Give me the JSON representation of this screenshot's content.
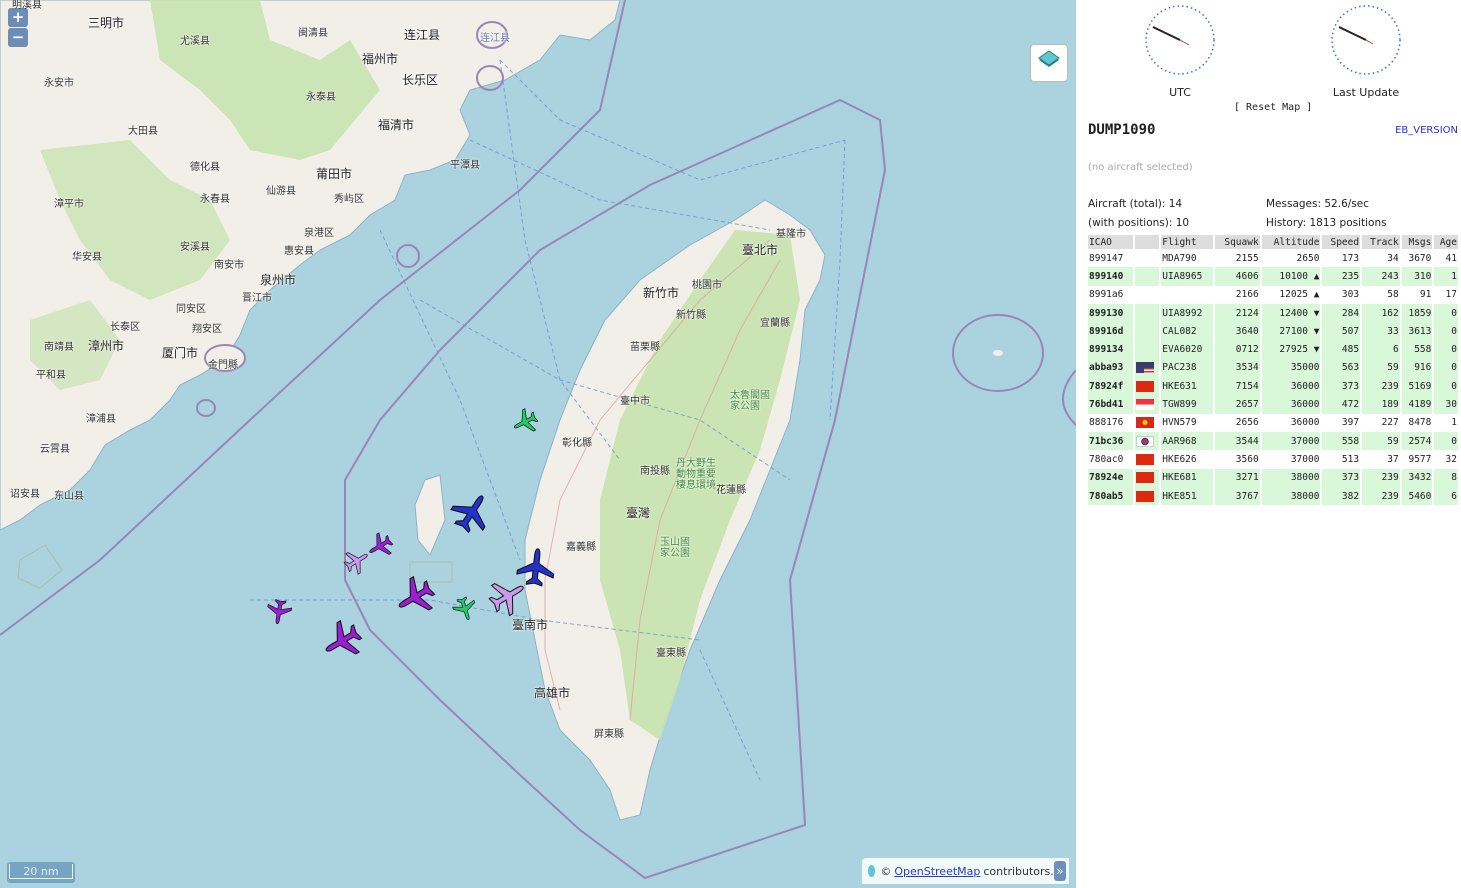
{
  "map": {
    "zoom_in": "+",
    "zoom_out": "−",
    "scale_label": "20 nm",
    "attribution_prefix": "©",
    "attribution_link": "OpenStreetMap",
    "attribution_suffix": "contributors.",
    "attribution_toggle": "»",
    "places": [
      {
        "text": "明溪县"
      },
      {
        "text": "三明市"
      },
      {
        "text": "尤溪县"
      },
      {
        "text": "闽清县"
      },
      {
        "text": "连江县"
      },
      {
        "text": "福州市"
      },
      {
        "text": "长乐区"
      },
      {
        "text": "永安市"
      },
      {
        "text": "永泰县"
      },
      {
        "text": "大田县"
      },
      {
        "text": "福清市"
      },
      {
        "text": "德化县"
      },
      {
        "text": "永春县"
      },
      {
        "text": "仙游县"
      },
      {
        "text": "莆田市"
      },
      {
        "text": "秀屿区"
      },
      {
        "text": "平潭县"
      },
      {
        "text": "漳平市"
      },
      {
        "text": "泉州市"
      },
      {
        "text": "泉港区"
      },
      {
        "text": "华安县"
      },
      {
        "text": "安溪县"
      },
      {
        "text": "惠安县"
      },
      {
        "text": "南安市"
      },
      {
        "text": "晋江市"
      },
      {
        "text": "同安区"
      },
      {
        "text": "长泰区"
      },
      {
        "text": "翔安区"
      },
      {
        "text": "南靖县"
      },
      {
        "text": "漳州市"
      },
      {
        "text": "厦门市"
      },
      {
        "text": "金門縣"
      },
      {
        "text": "平和县"
      },
      {
        "text": "漳浦县"
      },
      {
        "text": "云霄县"
      },
      {
        "text": "诏安县"
      },
      {
        "text": "东山县"
      },
      {
        "text": "基隆市"
      },
      {
        "text": "臺北市"
      },
      {
        "text": "桃園市"
      },
      {
        "text": "新竹市"
      },
      {
        "text": "新竹縣"
      },
      {
        "text": "宜蘭縣"
      },
      {
        "text": "苗栗縣"
      },
      {
        "text": "臺中市"
      },
      {
        "text": "彰化縣"
      },
      {
        "text": "南投縣"
      },
      {
        "text": "花蓮縣"
      },
      {
        "text": "臺灣"
      },
      {
        "text": "嘉義縣"
      },
      {
        "text": "臺南市"
      },
      {
        "text": "高雄市"
      },
      {
        "text": "臺東縣"
      },
      {
        "text": "屏東縣"
      },
      {
        "text": "太魯閣國家公園"
      },
      {
        "text": "玉山國家公園"
      },
      {
        "text": "丹大野生動物重要棲息環境"
      },
      {
        "text": "连江县"
      }
    ]
  },
  "sidebar": {
    "clock_utc": "UTC",
    "clock_last_update": "Last Update",
    "reset_map": "[ Reset Map ]",
    "title": "DUMP1090",
    "version": "EB_VERSION",
    "no_selection": "(no aircraft selected)",
    "stats": {
      "total": "Aircraft (total): 14",
      "messages": "Messages: 52.6/sec",
      "with_positions": "(with positions): 10",
      "history": "History: 1813 positions"
    },
    "columns": [
      "ICAO",
      "",
      "Flight",
      "Squawk",
      "Altitude",
      "Speed",
      "Track",
      "Msgs",
      "Age"
    ],
    "rows": [
      {
        "icao": "899147",
        "flag": "",
        "flight": "MDA790",
        "squawk": "2155",
        "altitude": "2650",
        "speed": "173",
        "track": "34",
        "msgs": "3670",
        "age": "41",
        "pos": false
      },
      {
        "icao": "899140",
        "flag": "",
        "flight": "UIA8965",
        "squawk": "4606",
        "altitude": "10100 ▲",
        "speed": "235",
        "track": "243",
        "msgs": "310",
        "age": "1",
        "pos": true
      },
      {
        "icao": "8991a6",
        "flag": "",
        "flight": "",
        "squawk": "2166",
        "altitude": "12025 ▲",
        "speed": "303",
        "track": "58",
        "msgs": "91",
        "age": "17",
        "pos": false
      },
      {
        "icao": "899130",
        "flag": "",
        "flight": "UIA8992",
        "squawk": "2124",
        "altitude": "12400 ▼",
        "speed": "284",
        "track": "162",
        "msgs": "1859",
        "age": "0",
        "pos": true
      },
      {
        "icao": "89916d",
        "flag": "",
        "flight": "CAL082",
        "squawk": "3640",
        "altitude": "27100 ▼",
        "speed": "507",
        "track": "33",
        "msgs": "3613",
        "age": "0",
        "pos": true
      },
      {
        "icao": "899134",
        "flag": "",
        "flight": "EVA6020",
        "squawk": "0712",
        "altitude": "27925 ▼",
        "speed": "485",
        "track": "6",
        "msgs": "558",
        "age": "0",
        "pos": true
      },
      {
        "icao": "abba93",
        "flag": "us",
        "flight": "PAC238",
        "squawk": "3534",
        "altitude": "35000",
        "speed": "563",
        "track": "59",
        "msgs": "916",
        "age": "0",
        "pos": true
      },
      {
        "icao": "78924f",
        "flag": "cn",
        "flight": "HKE631",
        "squawk": "7154",
        "altitude": "36000",
        "speed": "373",
        "track": "239",
        "msgs": "5169",
        "age": "0",
        "pos": true
      },
      {
        "icao": "76bd41",
        "flag": "sg",
        "flight": "TGW899",
        "squawk": "2657",
        "altitude": "36000",
        "speed": "472",
        "track": "189",
        "msgs": "4189",
        "age": "30",
        "pos": true
      },
      {
        "icao": "888176",
        "flag": "vn",
        "flight": "HVN579",
        "squawk": "2656",
        "altitude": "36000",
        "speed": "397",
        "track": "227",
        "msgs": "8478",
        "age": "1",
        "pos": false
      },
      {
        "icao": "71bc36",
        "flag": "kr",
        "flight": "AAR968",
        "squawk": "3544",
        "altitude": "37000",
        "speed": "558",
        "track": "59",
        "msgs": "2574",
        "age": "0",
        "pos": true
      },
      {
        "icao": "780ac0",
        "flag": "cn",
        "flight": "HKE626",
        "squawk": "3560",
        "altitude": "37000",
        "speed": "513",
        "track": "37",
        "msgs": "9577",
        "age": "32",
        "pos": false
      },
      {
        "icao": "78924e",
        "flag": "cn",
        "flight": "HKE681",
        "squawk": "3271",
        "altitude": "38000",
        "speed": "373",
        "track": "239",
        "msgs": "3432",
        "age": "8",
        "pos": true
      },
      {
        "icao": "780ab5",
        "flag": "cn",
        "flight": "HKE851",
        "squawk": "3767",
        "altitude": "38000",
        "speed": "382",
        "track": "239",
        "msgs": "5460",
        "age": "6",
        "pos": true
      }
    ]
  },
  "colors": {
    "sea": "#aad3df",
    "land": "#f2efe9",
    "park": "#c8e3b0",
    "row_positioned": "#d9f7d9",
    "plane_blue": "#2233cc",
    "plane_purple": "#9a1fd0",
    "plane_lilac": "#cc99ee",
    "plane_green": "#22cc66"
  },
  "aircraft_markers": [
    {
      "flight": "UIA8965",
      "color": "plane_green",
      "track": 243
    },
    {
      "flight": "CAL082",
      "color": "plane_blue",
      "track": 33
    },
    {
      "flight": "EVA6020",
      "color": "plane_blue",
      "track": 6
    },
    {
      "flight": "UIA8992",
      "color": "plane_green",
      "track": 162
    },
    {
      "flight": "PAC238",
      "color": "plane_lilac",
      "track": 59
    },
    {
      "flight": "HKE631",
      "color": "plane_purple",
      "track": 239
    },
    {
      "flight": "TGW899",
      "color": "plane_purple",
      "track": 189
    },
    {
      "flight": "AAR968",
      "color": "plane_lilac",
      "track": 59
    },
    {
      "flight": "HKE681",
      "color": "plane_purple",
      "track": 239
    },
    {
      "flight": "HKE851",
      "color": "plane_purple",
      "track": 239
    }
  ],
  "icons": {
    "layers": "layers-icon",
    "clock": "clock-icon",
    "flag": "flag-icon",
    "plane": "airplane-icon"
  }
}
